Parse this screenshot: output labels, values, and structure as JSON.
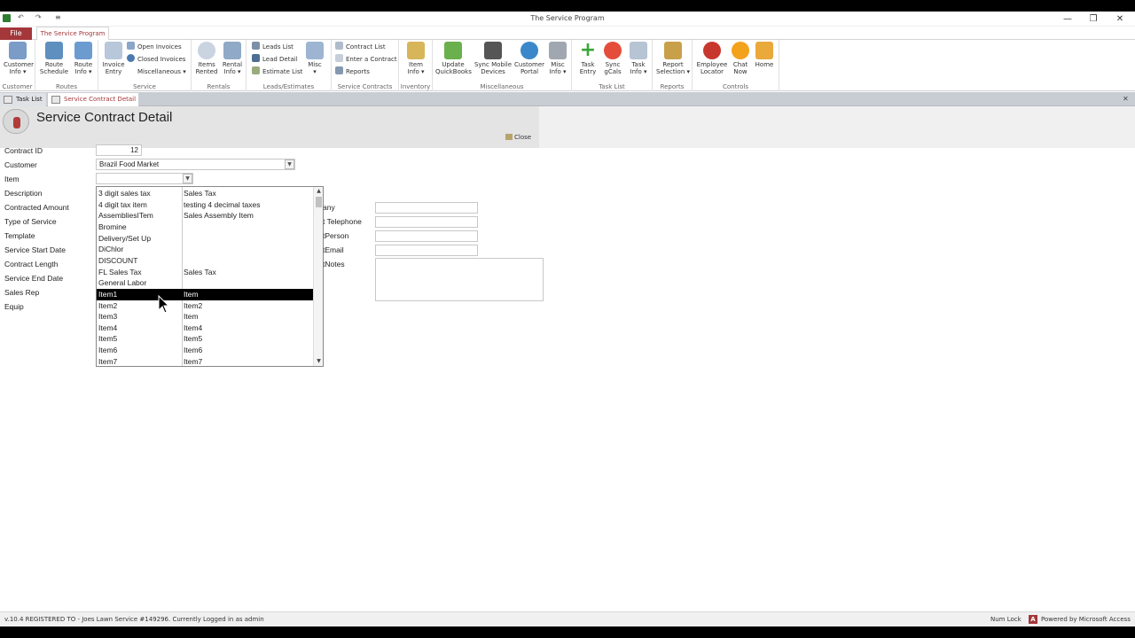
{
  "window": {
    "title": "The Service Program",
    "min": "—",
    "restore": "❐",
    "close": "✕"
  },
  "qat": {
    "undo": "↶",
    "redo": "↷",
    "customize": "≡"
  },
  "tabs": {
    "file": "File",
    "app": "The Service Program"
  },
  "ribbon": {
    "groups": {
      "customer": "Customer",
      "routes": "Routes",
      "service": "Service",
      "rentals": "Rentals",
      "leads": "Leads/Estimates",
      "contracts": "Service Contracts",
      "inventory": "Inventory",
      "misc": "Miscellaneous",
      "tasklist": "Task List",
      "reports": "Reports",
      "controls": "Controls"
    },
    "buttons": {
      "customer_info": [
        "Customer",
        "Info ▾"
      ],
      "route_schedule": [
        "Route",
        "Schedule"
      ],
      "route_info": [
        "Route",
        "Info ▾"
      ],
      "invoice_entry": [
        "Invoice",
        "Entry"
      ],
      "open_invoices": "Open Invoices",
      "closed_invoices": "Closed Invoices",
      "miscellaneous": "Miscellaneous ▾",
      "items_rented": [
        "Items",
        "Rented"
      ],
      "rental_info": [
        "Rental",
        "Info ▾"
      ],
      "leads_list": "Leads List",
      "lead_detail": "Lead Detail",
      "estimate_list": "Estimate List",
      "misc_leads": [
        "Misc",
        "▾"
      ],
      "contract_list": "Contract List",
      "enter_contract": "Enter a Contract",
      "reports_small": "Reports",
      "item_info": [
        "Item",
        "Info ▾"
      ],
      "update_qb": [
        "Update",
        "QuickBooks"
      ],
      "sync_mobile": [
        "Sync Mobile",
        "Devices"
      ],
      "customer_portal": [
        "Customer",
        "Portal"
      ],
      "misc_info": [
        "Misc",
        "Info ▾"
      ],
      "task_entry": [
        "Task",
        "Entry"
      ],
      "sync_gcals": [
        "Sync",
        "gCals"
      ],
      "task_info": [
        "Task",
        "Info ▾"
      ],
      "report_selection": [
        "Report",
        "Selection ▾"
      ],
      "employee_locator": [
        "Employee",
        "Locator"
      ],
      "chat_now": [
        "Chat",
        "Now"
      ],
      "home": [
        "Home",
        ""
      ]
    }
  },
  "doctabs": {
    "task_list": "Task List",
    "service_contract": "Service Contract Detail",
    "close": "✕"
  },
  "form": {
    "title": "Service Contract Detail",
    "close_label": "Close",
    "labels": {
      "contract_id": "Contract ID",
      "customer": "Customer",
      "item": "Item",
      "description": "Description",
      "contracted_amount": "Contracted Amount",
      "type_of_service": "Type of Service",
      "template": "Template",
      "service_start": "Service Start Date",
      "contract_length": "Contract Length",
      "service_end": "Service End Date",
      "sales_rep": "Sales Rep",
      "equip": "Equip"
    },
    "values": {
      "contract_id": "12",
      "customer": "Brazil Food Market",
      "item": ""
    },
    "right_labels": {
      "company": "any",
      "telephone": "t Telephone",
      "person": "tPerson",
      "email": "tEmail",
      "notes": "tNotes"
    }
  },
  "dropdown": {
    "rows": [
      {
        "name": "3 digit sales tax",
        "type": "Sales Tax"
      },
      {
        "name": "4 digit tax item",
        "type": "testing 4 decimal taxes"
      },
      {
        "name": "AssembliesITem",
        "type": "Sales Assembly Item"
      },
      {
        "name": "Bromine",
        "type": ""
      },
      {
        "name": "Delivery/Set Up",
        "type": ""
      },
      {
        "name": "DiChlor",
        "type": ""
      },
      {
        "name": "DISCOUNT",
        "type": ""
      },
      {
        "name": "FL Sales Tax",
        "type": "Sales Tax"
      },
      {
        "name": "General Labor",
        "type": ""
      },
      {
        "name": "Item1",
        "type": "Item",
        "selected": true
      },
      {
        "name": "Item2",
        "type": "Item2"
      },
      {
        "name": "Item3",
        "type": "Item"
      },
      {
        "name": "Item4",
        "type": "Item4"
      },
      {
        "name": "Item5",
        "type": "Item5"
      },
      {
        "name": "Item6",
        "type": "Item6"
      },
      {
        "name": "Item7",
        "type": "Item7"
      }
    ]
  },
  "status": {
    "left": "v.10.4 REGISTERED TO - Joes Lawn Service #149296. Currently Logged in as admin",
    "numlock": "Num Lock",
    "powered": "Powered by Microsoft Access"
  },
  "colors": {
    "accent": "#a4373a",
    "selection": "#000000"
  }
}
